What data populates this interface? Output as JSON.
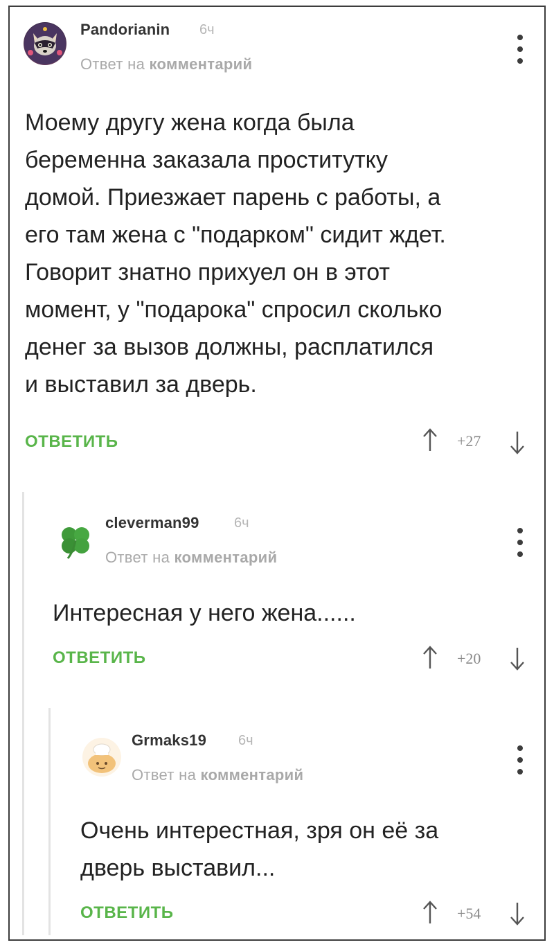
{
  "comments": [
    {
      "username": "Pandorianin",
      "time": "6ч",
      "reply_prefix": "Ответ на ",
      "reply_link": "комментарий",
      "text_lines": [
        "Моему другу жена когда была",
        "беременна заказала проститутку",
        "домой. Приезжает парень с работы, а",
        "его там жена с \"подарком\" сидит ждет.",
        "Говорит знатно прихуел он в этот",
        "момент,  у \"подарока\" спросил сколько",
        "денег за вызов должны, расплатился",
        "и выставил за дверь."
      ],
      "reply_label": "ОТВЕТИТЬ",
      "rating": "+27"
    },
    {
      "username": "cleverman99",
      "time": "6ч",
      "reply_prefix": "Ответ на ",
      "reply_link": "комментарий",
      "text_lines": [
        "Интересная у него жена......"
      ],
      "reply_label": "ОТВЕТИТЬ",
      "rating": "+20"
    },
    {
      "username": "Grmaks19",
      "time": "6ч",
      "reply_prefix": "Ответ на ",
      "reply_link": "комментарий",
      "text_lines": [
        "Очень интерестная, зря он её за",
        "дверь выставил..."
      ],
      "reply_label": "ОТВЕТИТЬ",
      "rating": "+54"
    }
  ],
  "colors": {
    "accent_green": "#59b54a",
    "muted_text": "#a9a9a9",
    "thread_line": "#e3e3e3"
  },
  "icons": {
    "avatar_1": "raccoon-avatar",
    "avatar_2": "clover-avatar",
    "avatar_3": "chef-avatar",
    "vote_up": "arrow-up-icon",
    "vote_down": "arrow-down-icon",
    "menu": "more-vertical-icon"
  }
}
